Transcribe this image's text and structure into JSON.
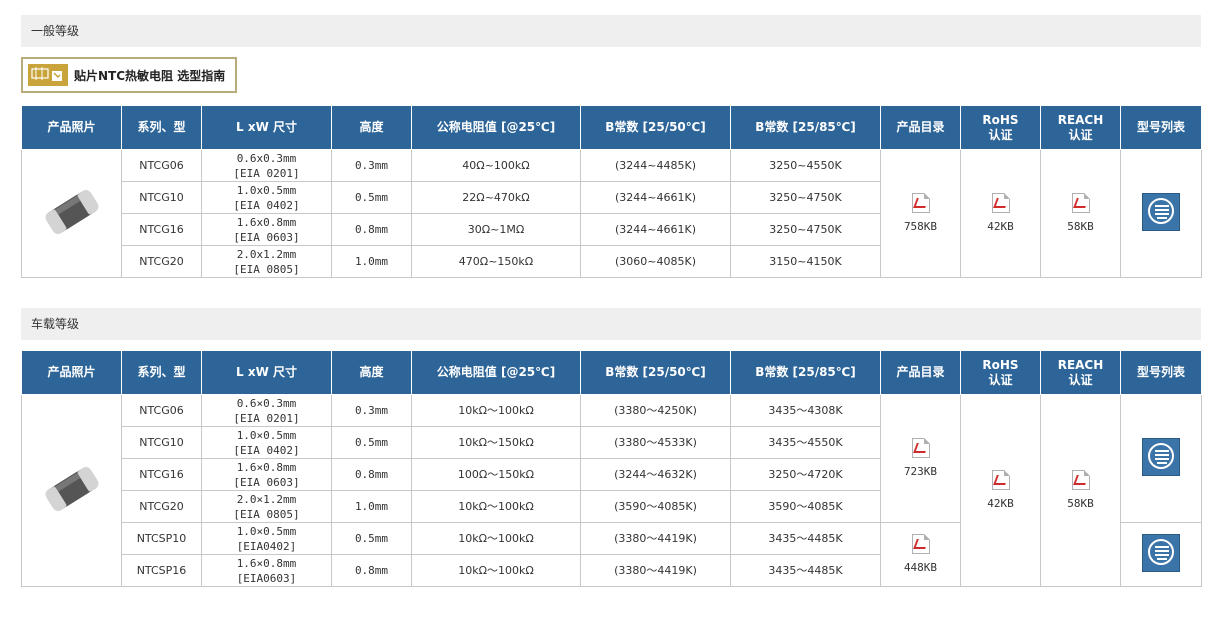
{
  "sections": [
    {
      "title": "一般等级"
    },
    {
      "title": "车载等级"
    }
  ],
  "guide": {
    "label": "贴片NTC热敏电阻 选型指南",
    "icon": "guide-banner-icon"
  },
  "headers": {
    "photo": "产品照片",
    "series": "系列、型",
    "size": "L xW 尺寸",
    "height": "高度",
    "resistance": "公称电阻值 [@25℃]",
    "b50": "B常数 [25/50℃]",
    "b85": "B常数 [25/85℃]",
    "catalog": "产品目录",
    "rohs_1": "RoHS",
    "rohs_2": "认证",
    "reach_1": "REACH",
    "reach_2": "认证",
    "list": "型号列表"
  },
  "general": {
    "rows": [
      {
        "series": "NTCG06",
        "size_1": "0.6x0.3mm",
        "size_2": "[EIA 0201]",
        "height": "0.3mm",
        "resistance": "40Ω~100kΩ",
        "b50": "(3244~4485K)",
        "b85": "3250~4550K"
      },
      {
        "series": "NTCG10",
        "size_1": "1.0x0.5mm",
        "size_2": "[EIA 0402]",
        "height": "0.5mm",
        "resistance": "22Ω~470kΩ",
        "b50": "(3244~4661K)",
        "b85": "3250~4750K"
      },
      {
        "series": "NTCG16",
        "size_1": "1.6x0.8mm",
        "size_2": "[EIA 0603]",
        "height": "0.8mm",
        "resistance": "30Ω~1MΩ",
        "b50": "(3244~4661K)",
        "b85": "3250~4750K"
      },
      {
        "series": "NTCG20",
        "size_1": "2.0x1.2mm",
        "size_2": "[EIA 0805]",
        "height": "1.0mm",
        "resistance": "470Ω~150kΩ",
        "b50": "(3060~4085K)",
        "b85": "3150~4150K"
      }
    ],
    "catalog_size": "758KB",
    "rohs_size": "42KB",
    "reach_size": "58KB"
  },
  "automotive": {
    "rows": [
      {
        "series": "NTCG06",
        "size_1": "0.6×0.3mm",
        "size_2": "[EIA 0201]",
        "height": "0.3mm",
        "resistance": "10kΩ～100kΩ",
        "b50": "(3380～4250K)",
        "b85": "3435～4308K"
      },
      {
        "series": "NTCG10",
        "size_1": "1.0×0.5mm",
        "size_2": "[EIA 0402]",
        "height": "0.5mm",
        "resistance": "10kΩ～150kΩ",
        "b50": "(3380～4533K)",
        "b85": "3435～4550K"
      },
      {
        "series": "NTCG16",
        "size_1": "1.6×0.8mm",
        "size_2": "[EIA 0603]",
        "height": "0.8mm",
        "resistance": "100Ω～150kΩ",
        "b50": "(3244～4632K)",
        "b85": "3250～4720K"
      },
      {
        "series": "NTCG20",
        "size_1": "2.0×1.2mm",
        "size_2": "[EIA 0805]",
        "height": "1.0mm",
        "resistance": "10kΩ～100kΩ",
        "b50": "(3590～4085K)",
        "b85": "3590～4085K"
      },
      {
        "series": "NTCSP10",
        "size_1": "1.0×0.5mm",
        "size_2": "[EIA0402]",
        "height": "0.5mm",
        "resistance": "10kΩ～100kΩ",
        "b50": "(3380～4419K)",
        "b85": "3435～4485K"
      },
      {
        "series": "NTCSP16",
        "size_1": "1.6×0.8mm",
        "size_2": "[EIA0603]",
        "height": "0.8mm",
        "resistance": "10kΩ～100kΩ",
        "b50": "(3380～4419K)",
        "b85": "3435～4485K"
      }
    ],
    "catalog_size_ntcg": "723KB",
    "catalog_size_ntcsp": "448KB",
    "rohs_size": "42KB",
    "reach_size": "58KB"
  },
  "colors": {
    "header_bg": "#2e6598",
    "section_bg": "#efefef",
    "pdf_red": "#d12c2c",
    "list_icon_bg": "#3b74a8"
  },
  "icons": {
    "chip": "chip-photo",
    "pdf": "pdf-icon",
    "list": "model-list-icon"
  }
}
